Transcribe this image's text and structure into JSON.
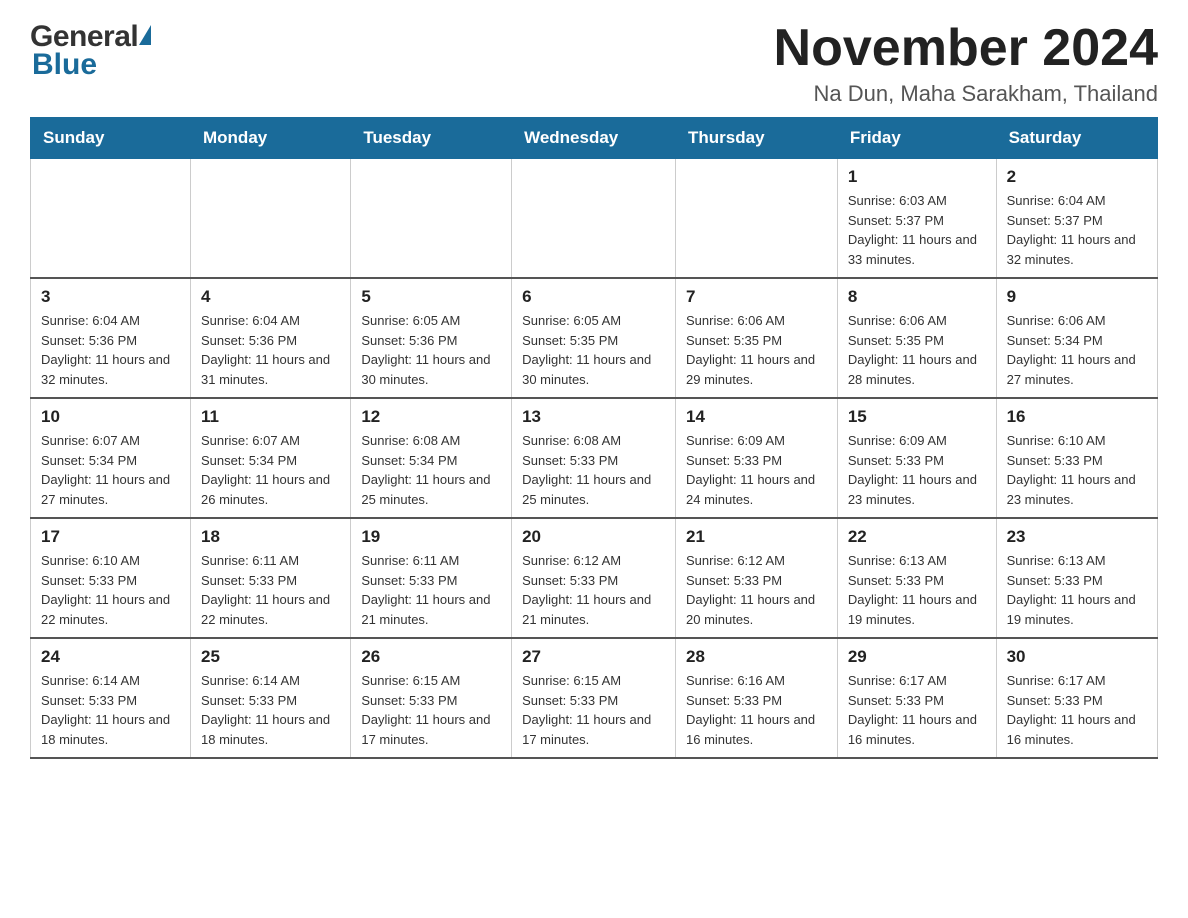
{
  "logo": {
    "general": "General",
    "blue": "Blue"
  },
  "header": {
    "title": "November 2024",
    "subtitle": "Na Dun, Maha Sarakham, Thailand"
  },
  "weekdays": [
    "Sunday",
    "Monday",
    "Tuesday",
    "Wednesday",
    "Thursday",
    "Friday",
    "Saturday"
  ],
  "weeks": [
    [
      {
        "day": "",
        "info": ""
      },
      {
        "day": "",
        "info": ""
      },
      {
        "day": "",
        "info": ""
      },
      {
        "day": "",
        "info": ""
      },
      {
        "day": "",
        "info": ""
      },
      {
        "day": "1",
        "info": "Sunrise: 6:03 AM\nSunset: 5:37 PM\nDaylight: 11 hours and 33 minutes."
      },
      {
        "day": "2",
        "info": "Sunrise: 6:04 AM\nSunset: 5:37 PM\nDaylight: 11 hours and 32 minutes."
      }
    ],
    [
      {
        "day": "3",
        "info": "Sunrise: 6:04 AM\nSunset: 5:36 PM\nDaylight: 11 hours and 32 minutes."
      },
      {
        "day": "4",
        "info": "Sunrise: 6:04 AM\nSunset: 5:36 PM\nDaylight: 11 hours and 31 minutes."
      },
      {
        "day": "5",
        "info": "Sunrise: 6:05 AM\nSunset: 5:36 PM\nDaylight: 11 hours and 30 minutes."
      },
      {
        "day": "6",
        "info": "Sunrise: 6:05 AM\nSunset: 5:35 PM\nDaylight: 11 hours and 30 minutes."
      },
      {
        "day": "7",
        "info": "Sunrise: 6:06 AM\nSunset: 5:35 PM\nDaylight: 11 hours and 29 minutes."
      },
      {
        "day": "8",
        "info": "Sunrise: 6:06 AM\nSunset: 5:35 PM\nDaylight: 11 hours and 28 minutes."
      },
      {
        "day": "9",
        "info": "Sunrise: 6:06 AM\nSunset: 5:34 PM\nDaylight: 11 hours and 27 minutes."
      }
    ],
    [
      {
        "day": "10",
        "info": "Sunrise: 6:07 AM\nSunset: 5:34 PM\nDaylight: 11 hours and 27 minutes."
      },
      {
        "day": "11",
        "info": "Sunrise: 6:07 AM\nSunset: 5:34 PM\nDaylight: 11 hours and 26 minutes."
      },
      {
        "day": "12",
        "info": "Sunrise: 6:08 AM\nSunset: 5:34 PM\nDaylight: 11 hours and 25 minutes."
      },
      {
        "day": "13",
        "info": "Sunrise: 6:08 AM\nSunset: 5:33 PM\nDaylight: 11 hours and 25 minutes."
      },
      {
        "day": "14",
        "info": "Sunrise: 6:09 AM\nSunset: 5:33 PM\nDaylight: 11 hours and 24 minutes."
      },
      {
        "day": "15",
        "info": "Sunrise: 6:09 AM\nSunset: 5:33 PM\nDaylight: 11 hours and 23 minutes."
      },
      {
        "day": "16",
        "info": "Sunrise: 6:10 AM\nSunset: 5:33 PM\nDaylight: 11 hours and 23 minutes."
      }
    ],
    [
      {
        "day": "17",
        "info": "Sunrise: 6:10 AM\nSunset: 5:33 PM\nDaylight: 11 hours and 22 minutes."
      },
      {
        "day": "18",
        "info": "Sunrise: 6:11 AM\nSunset: 5:33 PM\nDaylight: 11 hours and 22 minutes."
      },
      {
        "day": "19",
        "info": "Sunrise: 6:11 AM\nSunset: 5:33 PM\nDaylight: 11 hours and 21 minutes."
      },
      {
        "day": "20",
        "info": "Sunrise: 6:12 AM\nSunset: 5:33 PM\nDaylight: 11 hours and 21 minutes."
      },
      {
        "day": "21",
        "info": "Sunrise: 6:12 AM\nSunset: 5:33 PM\nDaylight: 11 hours and 20 minutes."
      },
      {
        "day": "22",
        "info": "Sunrise: 6:13 AM\nSunset: 5:33 PM\nDaylight: 11 hours and 19 minutes."
      },
      {
        "day": "23",
        "info": "Sunrise: 6:13 AM\nSunset: 5:33 PM\nDaylight: 11 hours and 19 minutes."
      }
    ],
    [
      {
        "day": "24",
        "info": "Sunrise: 6:14 AM\nSunset: 5:33 PM\nDaylight: 11 hours and 18 minutes."
      },
      {
        "day": "25",
        "info": "Sunrise: 6:14 AM\nSunset: 5:33 PM\nDaylight: 11 hours and 18 minutes."
      },
      {
        "day": "26",
        "info": "Sunrise: 6:15 AM\nSunset: 5:33 PM\nDaylight: 11 hours and 17 minutes."
      },
      {
        "day": "27",
        "info": "Sunrise: 6:15 AM\nSunset: 5:33 PM\nDaylight: 11 hours and 17 minutes."
      },
      {
        "day": "28",
        "info": "Sunrise: 6:16 AM\nSunset: 5:33 PM\nDaylight: 11 hours and 16 minutes."
      },
      {
        "day": "29",
        "info": "Sunrise: 6:17 AM\nSunset: 5:33 PM\nDaylight: 11 hours and 16 minutes."
      },
      {
        "day": "30",
        "info": "Sunrise: 6:17 AM\nSunset: 5:33 PM\nDaylight: 11 hours and 16 minutes."
      }
    ]
  ]
}
